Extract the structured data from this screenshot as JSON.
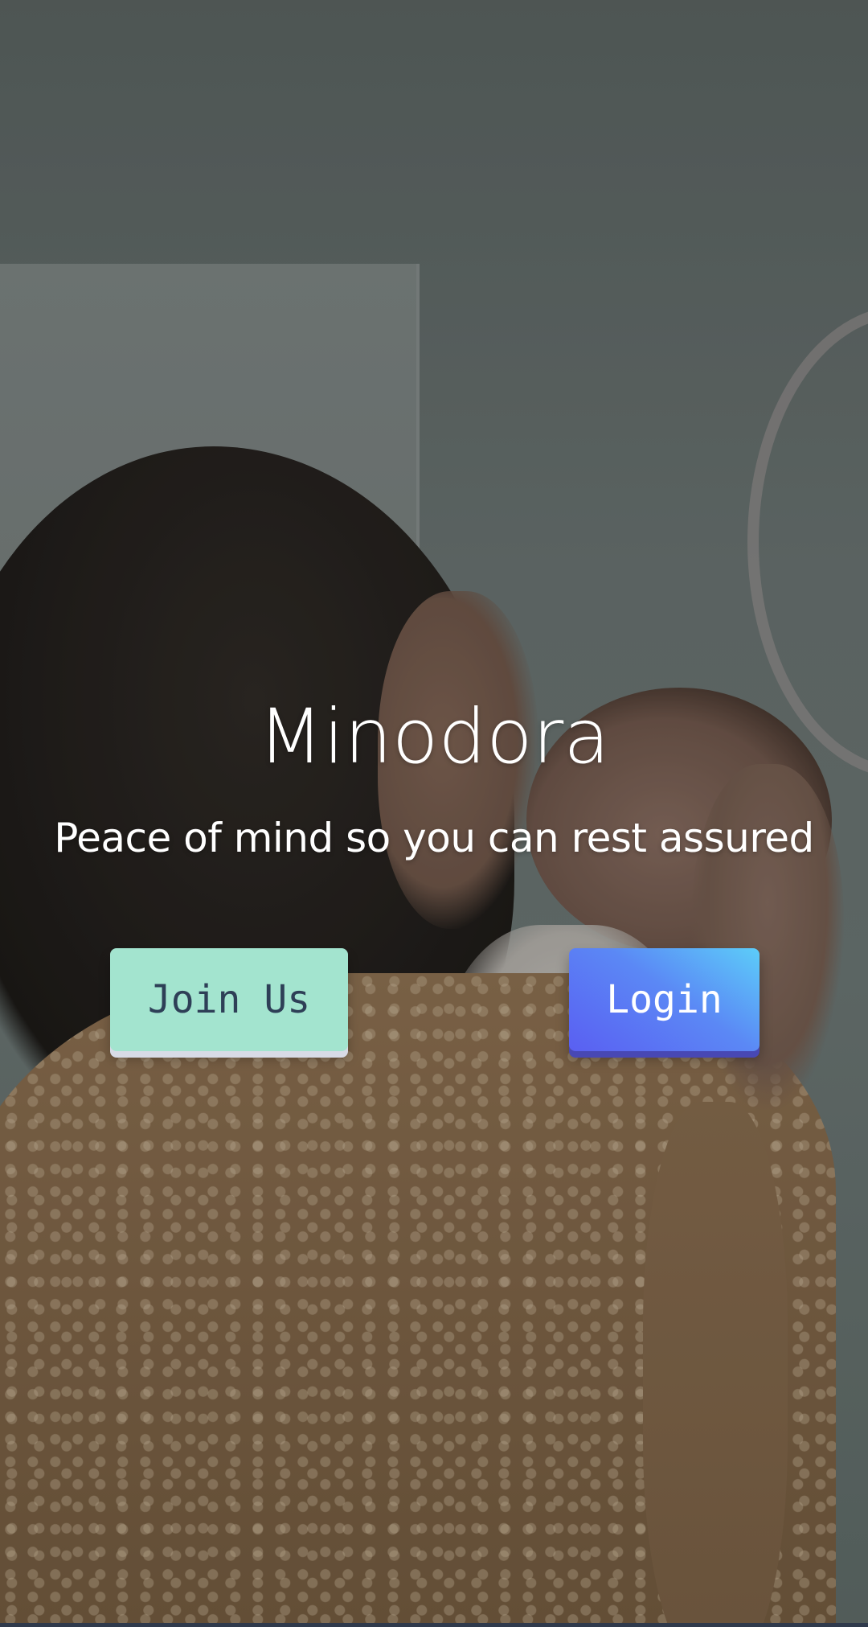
{
  "app": {
    "title": "Minodora",
    "tagline": "Peace of mind so you can rest assured"
  },
  "buttons": {
    "join_label": "Join Us",
    "login_label": "Login"
  },
  "colors": {
    "join_button": "#a3e4cf",
    "join_text": "#2e3f57",
    "login_gradient_start": "#5ccdf9",
    "login_gradient_end": "#5a5ff2",
    "login_text": "#ffffff"
  },
  "background": {
    "image_subject": "mother-and-newborn-photo"
  }
}
